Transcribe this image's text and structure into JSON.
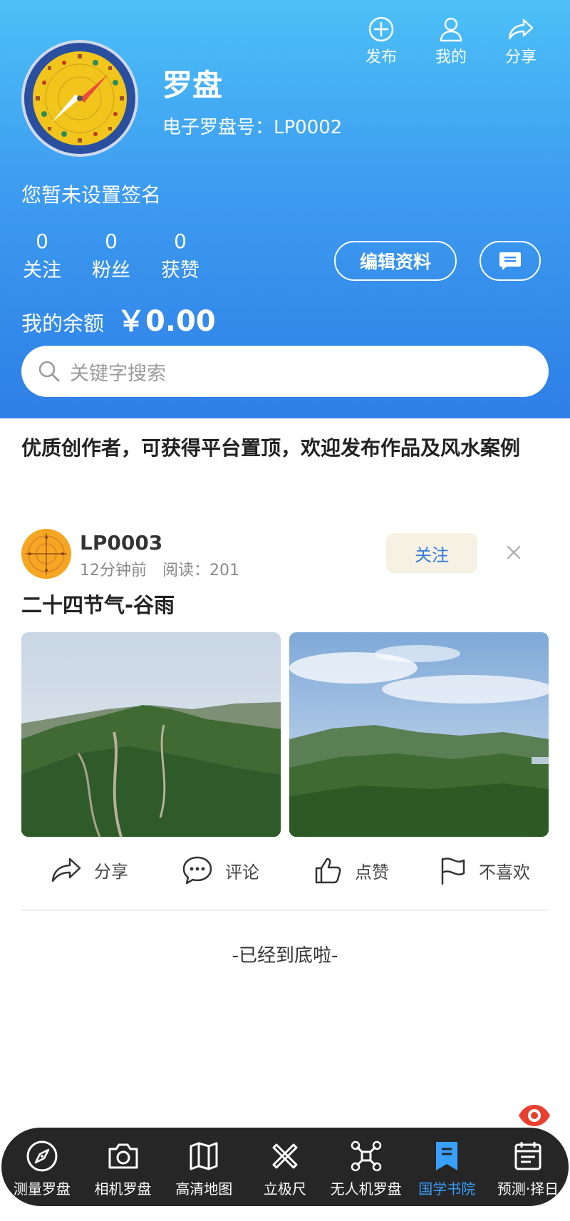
{
  "top_actions": [
    {
      "label": "发布",
      "icon": "plus-circle-icon"
    },
    {
      "label": "我的",
      "icon": "user-icon"
    },
    {
      "label": "分享",
      "icon": "share-icon"
    }
  ],
  "profile": {
    "name": "罗盘",
    "id_label": "电子罗盘号：",
    "id_value": "LP0002",
    "signature": "您暂未设置签名"
  },
  "stats": [
    {
      "value": "0",
      "label": "关注"
    },
    {
      "value": "0",
      "label": "粉丝"
    },
    {
      "value": "0",
      "label": "获赞"
    }
  ],
  "edit_button": "编辑资料",
  "balance": {
    "label": "我的余额",
    "amount": "￥0.00"
  },
  "search": {
    "placeholder": "关键字搜索"
  },
  "notice": "优质创作者，可获得平台置顶，欢迎发布作品及风水案例",
  "post": {
    "author": "LP0003",
    "time": "12分钟前",
    "reads_label": "阅读：",
    "reads": "201",
    "follow": "关注",
    "title": "二十四节气-谷雨",
    "images": [
      "mountain-photo-1",
      "mountain-photo-2"
    ],
    "actions": [
      {
        "label": "分享",
        "icon": "share-icon"
      },
      {
        "label": "评论",
        "icon": "comment-icon"
      },
      {
        "label": "点赞",
        "icon": "thumbs-up-icon"
      },
      {
        "label": "不喜欢",
        "icon": "flag-icon"
      }
    ]
  },
  "end_text": "-已经到底啦-",
  "bottom_nav": [
    {
      "label": "测量罗盘",
      "icon": "compass-icon",
      "active": false
    },
    {
      "label": "相机罗盘",
      "icon": "camera-icon",
      "active": false
    },
    {
      "label": "高清地图",
      "icon": "map-icon",
      "active": false
    },
    {
      "label": "立极尺",
      "icon": "ruler-cross-icon",
      "active": false
    },
    {
      "label": "无人机罗盘",
      "icon": "drone-icon",
      "active": false
    },
    {
      "label": "国学书院",
      "icon": "bookmark-icon",
      "active": true
    },
    {
      "label": "预测·择日",
      "icon": "calendar-icon",
      "active": false
    }
  ],
  "colors": {
    "header_top": "#4cc0f7",
    "header_bottom": "#2e7fe6",
    "nav_bg": "#262626",
    "nav_active": "#3aa0ff",
    "follow_text": "#2f7de0"
  }
}
